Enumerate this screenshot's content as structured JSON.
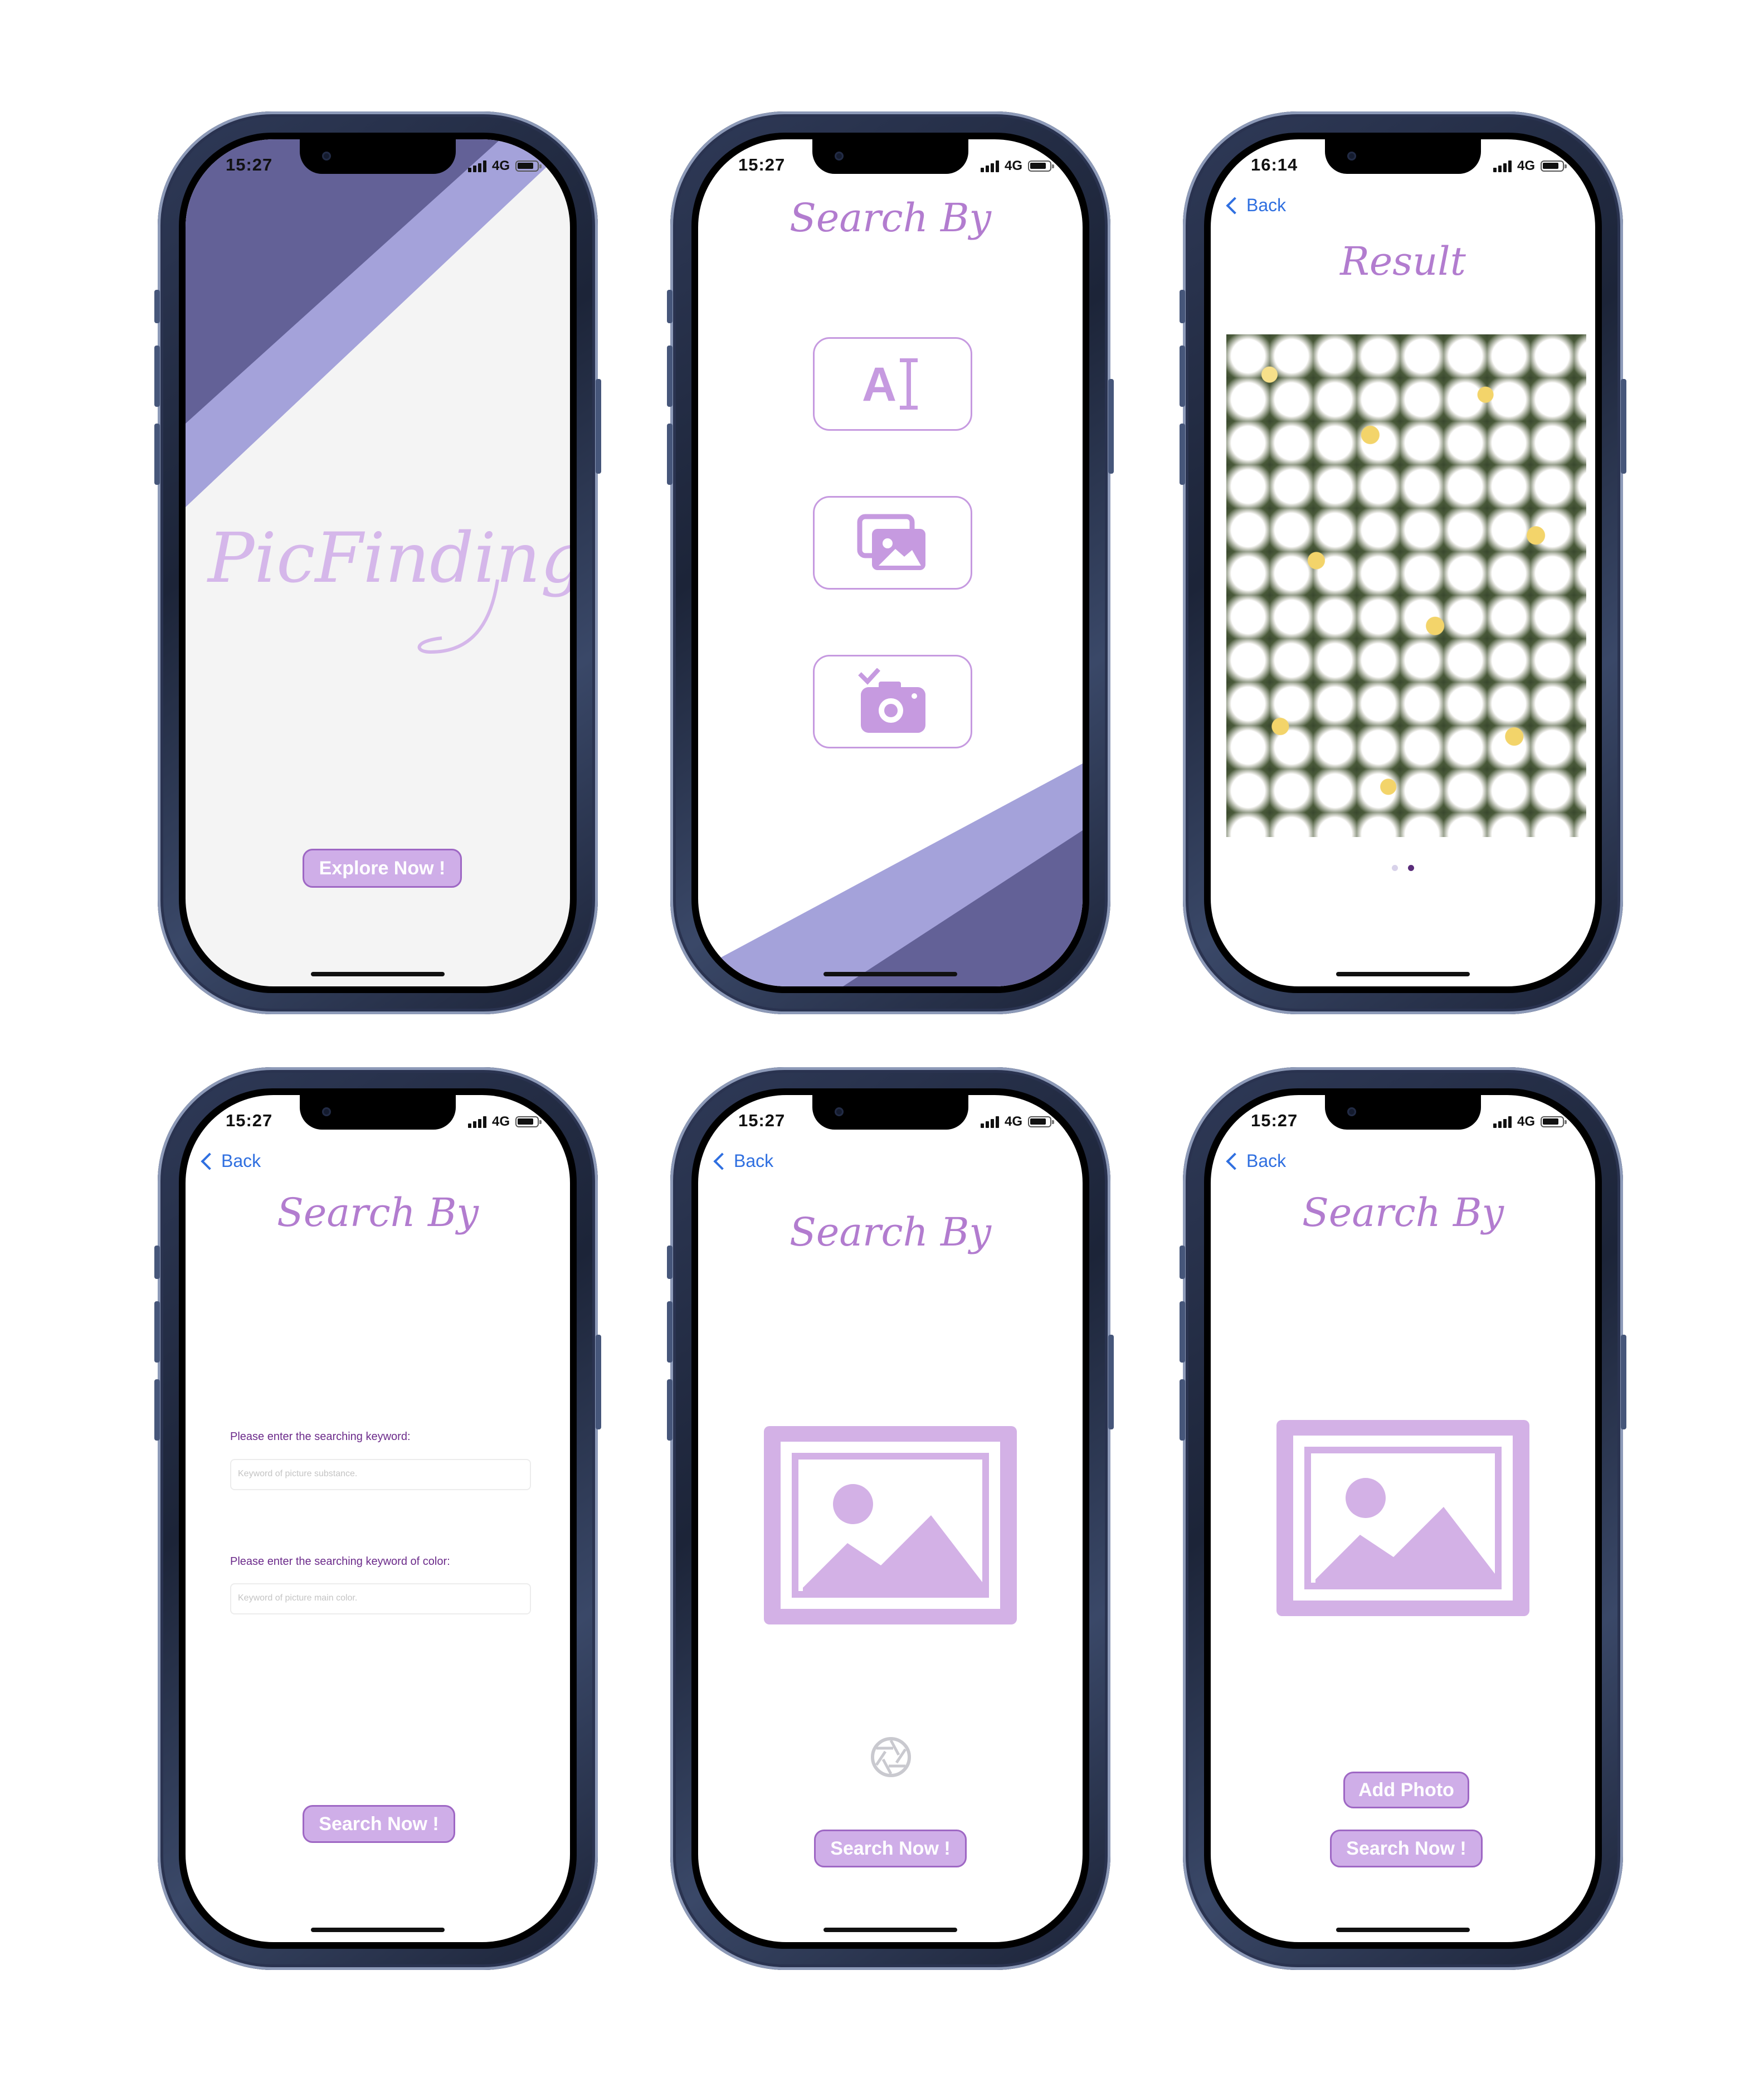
{
  "colors": {
    "accent_light": "#cfaee8",
    "accent_border": "#9e67c4",
    "script_text": "#b27ccf",
    "band_dark": "#636197",
    "band_light": "#a4a2da",
    "back_link": "#2f6fe0",
    "placeholder_icon": "#d3b1e6"
  },
  "status_bar": {
    "network": "4G"
  },
  "screens": {
    "welcome": {
      "time": "15:27",
      "logo": "PicFinding",
      "button": "Explore Now !"
    },
    "search_menu": {
      "time": "15:27",
      "title": "Search By",
      "options": [
        "text-search-icon",
        "gallery-icon",
        "camera-icon"
      ]
    },
    "result": {
      "time": "16:14",
      "back": "Back",
      "title": "Result",
      "image": "daisy-flowers-photo",
      "pages": 2,
      "current_page": 2
    },
    "keyword_search": {
      "time": "15:27",
      "back": "Back",
      "title": "Search By",
      "label_keyword": "Please enter the searching keyword:",
      "placeholder_keyword": "Keyword of picture substance.",
      "label_color": "Please enter the searching keyword of color:",
      "placeholder_color": "Keyword of picture main color.",
      "button": "Search Now !"
    },
    "camera_search": {
      "time": "15:27",
      "back": "Back",
      "title": "Search By",
      "icon": "shutter-icon",
      "button": "Search Now !"
    },
    "photo_search": {
      "time": "15:27",
      "back": "Back",
      "title": "Search By",
      "add_button": "Add Photo",
      "button": "Search Now !"
    }
  }
}
